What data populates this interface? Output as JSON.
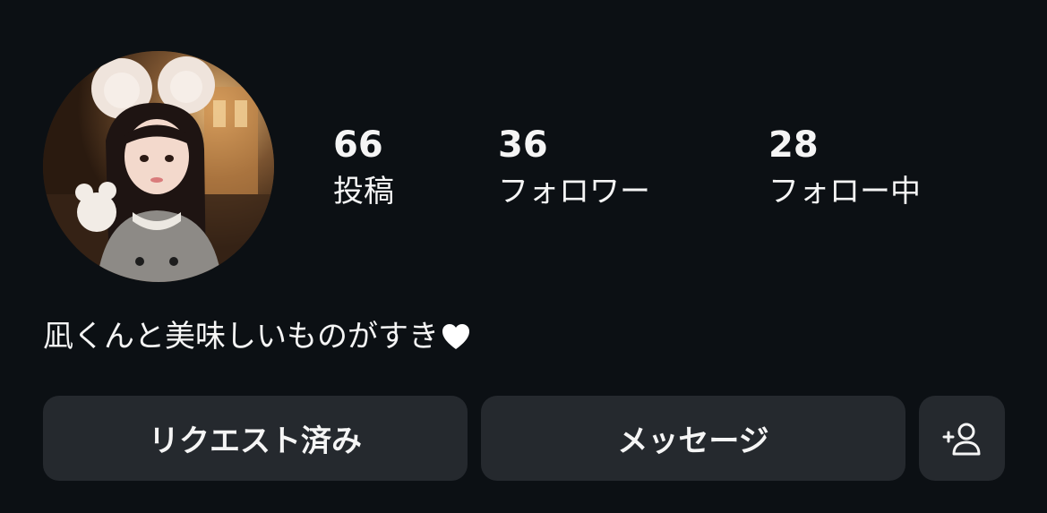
{
  "profile": {
    "avatar_icon": "profile-photo",
    "stats": {
      "posts_count": "66",
      "posts_label": "投稿",
      "followers_count": "36",
      "followers_label": "フォロワー",
      "following_count": "28",
      "following_label": "フォロー中"
    },
    "bio": {
      "text": "凪くんと美味しいものがすき",
      "icon": "heart-icon"
    },
    "actions": {
      "request_label": "リクエスト済み",
      "message_label": "メッセージ",
      "add_user_icon": "add-user-icon"
    }
  },
  "colors": {
    "background": "#0c1014",
    "button": "#25292e",
    "text": "#f5f5f5"
  }
}
